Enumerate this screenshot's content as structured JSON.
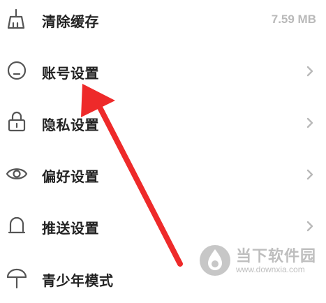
{
  "settings_menu": {
    "items": [
      {
        "id": "clear-cache",
        "label": "清除缓存",
        "value": "7.59 MB",
        "icon": "broom-icon"
      },
      {
        "id": "account",
        "label": "账号设置",
        "icon": "account-icon"
      },
      {
        "id": "privacy",
        "label": "隐私设置",
        "icon": "lock-icon"
      },
      {
        "id": "preferences",
        "label": "偏好设置",
        "icon": "eye-icon"
      },
      {
        "id": "push",
        "label": "推送设置",
        "icon": "bell-icon"
      },
      {
        "id": "youth-mode",
        "label": "青少年模式",
        "icon": "umbrella-icon"
      }
    ]
  },
  "annotation": {
    "arrow_color": "#ee2a2a"
  },
  "watermark": {
    "name": "当下软件园",
    "url": "www.downxia.com"
  },
  "colors": {
    "label": "#222222",
    "icon": "#555555",
    "secondary": "#b9b9b9"
  }
}
